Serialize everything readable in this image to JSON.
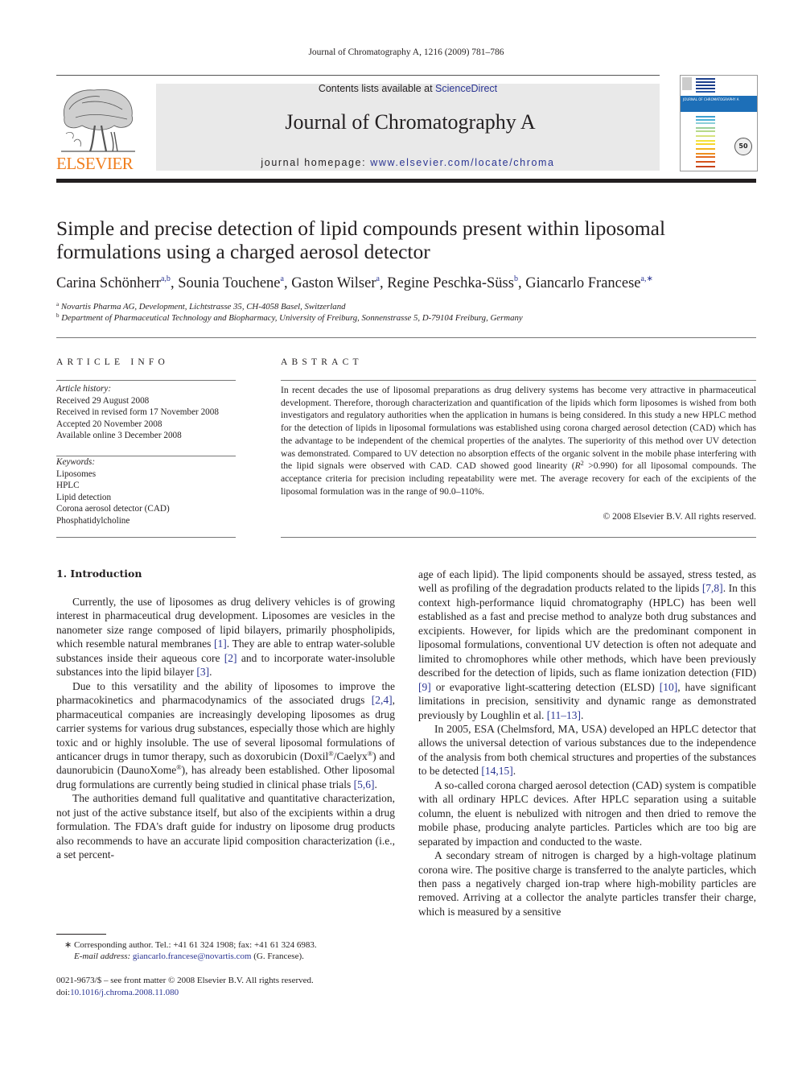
{
  "running_head": "Journal of Chromatography A, 1216 (2009) 781–786",
  "masthead": {
    "publisher_logo": "ELSEVIER",
    "contents_prefix": "Contents lists available at ",
    "contents_link": "ScienceDirect",
    "journal_title": "Journal of Chromatography A",
    "homepage_prefix": "journal homepage: ",
    "homepage_link": "www.elsevier.com/locate/chroma",
    "cover": {
      "band_title": "JOURNAL OF CHROMATOGRAPHY A",
      "seal_text": "50",
      "stripe_colors": [
        "#1c3f8c",
        "#1c3f8c",
        "#1c3f8c",
        "#1c3f8c",
        "#2a5aa8",
        "#3ea0d0",
        "#4db3d6",
        "#8ccfd8",
        "#9ccf9a",
        "#b6d98a",
        "#d7e27c",
        "#f3e23a",
        "#f6d62a",
        "#f3b31f",
        "#ee8f1e",
        "#e46a1e",
        "#d6541b",
        "#c8431a"
      ]
    }
  },
  "article": {
    "title": "Simple and precise detection of lipid compounds present within liposomal formulations using a charged aerosol detector",
    "authors": [
      {
        "name": "Carina Schönherr",
        "aff": "a,b"
      },
      {
        "name": "Sounia Touchene",
        "aff": "a"
      },
      {
        "name": "Gaston Wilser",
        "aff": "a"
      },
      {
        "name": "Regine Peschka-Süss",
        "aff": "b"
      },
      {
        "name": "Giancarlo Francese",
        "aff": "a,∗"
      }
    ],
    "affiliations": [
      {
        "mark": "a",
        "text": "Novartis Pharma AG, Development, Lichtstrasse 35, CH-4058 Basel, Switzerland"
      },
      {
        "mark": "b",
        "text": "Department of Pharmaceutical Technology and Biopharmacy, University of Freiburg, Sonnenstrasse 5, D-79104 Freiburg, Germany"
      }
    ]
  },
  "article_info": {
    "heading": "ARTICLE INFO",
    "history_label": "Article history:",
    "history": [
      "Received 29 August 2008",
      "Received in revised form 17 November 2008",
      "Accepted 20 November 2008",
      "Available online 3 December 2008"
    ],
    "keywords_label": "Keywords:",
    "keywords": [
      "Liposomes",
      "HPLC",
      "Lipid detection",
      "Corona aerosol detector (CAD)",
      "Phosphatidylcholine"
    ]
  },
  "abstract": {
    "heading": "ABSTRACT",
    "text_1": "In recent decades the use of liposomal preparations as drug delivery systems has become very attractive in pharmaceutical development. Therefore, thorough characterization and quantification of the lipids which form liposomes is wished from both investigators and regulatory authorities when the application in humans is being considered. In this study a new HPLC method for the detection of lipids in liposomal formulations was established using corona charged aerosol detection (CAD) which has the advantage to be independent of the chemical properties of the analytes. The superiority of this method over UV detection was demonstrated. Compared to UV detection no absorption effects of the organic solvent in the mobile phase interfering with the lipid signals were observed with CAD. CAD showed good linearity (",
    "r_symbol": "R",
    "r_sup": "2",
    "text_2": " >0.990) for all liposomal compounds. The acceptance criteria for precision including repeatability were met. The average recovery for each of the excipients of the liposomal formulation was in the range of 90.0–110%.",
    "copyright": "© 2008 Elsevier B.V. All rights reserved."
  },
  "introduction": {
    "heading": "1.  Introduction",
    "p1": {
      "a": "Currently, the use of liposomes as drug delivery vehicles is of growing interest in pharmaceutical drug development. Liposomes are vesicles in the nanometer size range composed of lipid bilayers, primarily phospholipids, which resemble natural membranes ",
      "ref1": "[1]",
      "b": ". They are able to entrap water-soluble substances inside their aqueous core ",
      "ref2": "[2]",
      "c": " and to incorporate water-insoluble substances into the lipid bilayer ",
      "ref3": "[3]",
      "d": "."
    },
    "p2": {
      "a": "Due to this versatility and the ability of liposomes to improve the pharmacokinetics and pharmacodynamics of the associated drugs ",
      "ref1": "[2,4]",
      "b": ", pharmaceutical companies are increasingly developing liposomes as drug carrier systems for various drug substances, especially those which are highly toxic and or highly insoluble. The use of several liposomal formulations of anticancer drugs in tumor therapy, such as doxorubicin (Doxil",
      "reg": "®",
      "c": "/Caelyx",
      "d": ") and daunorubicin (DaunoXome",
      "e": "), has already been established. Other liposomal drug formulations are currently being studied in clinical phase trials ",
      "ref2": "[5,6]",
      "f": "."
    },
    "p3": {
      "a": "The authorities demand full qualitative and quantitative characterization, not just of the active substance itself, but also of the excipients within a drug formulation. The FDA's draft guide for industry on liposome drug products also recommends to have an accurate lipid composition characterization (i.e., a set percentage of each lipid). The lipid components should be assayed, stress tested, as well as profiling of the degradation products related to the lipids ",
      "ref1": "[7,8]",
      "b": ". In this context high-performance liquid chromatography (HPLC) has been well established as a fast and precise method to analyze both drug substances and excipients. However, for lipids which are the predominant component in liposomal formulations, conventional UV detection is often not adequate and limited to chromophores while other methods, which have been previously described for the detection of lipids, such as flame ionization detection (FID) ",
      "ref2": "[9]",
      "c": " or evaporative light-scattering detection (ELSD) ",
      "ref3": "[10]",
      "d": ", have significant limitations in precision, sensitivity and dynamic range as demonstrated previously by Loughlin et al. ",
      "ref4": "[11–13]",
      "e": "."
    },
    "p4": {
      "a": "In 2005, ESA (Chelmsford, MA, USA) developed an HPLC detector that allows the universal detection of various substances due to the independence of the analysis from both chemical structures and properties of the substances to be detected ",
      "ref1": "[14,15]",
      "b": "."
    },
    "p5": "A so-called corona charged aerosol detection (CAD) system is compatible with all ordinary HPLC devices. After HPLC separation using a suitable column, the eluent is nebulized with nitrogen and then dried to remove the mobile phase, producing analyte particles. Particles which are too big are separated by impaction and conducted to the waste.",
    "p6": "A secondary stream of nitrogen is charged by a high-voltage platinum corona wire. The positive charge is transferred to the analyte particles, which then pass a negatively charged ion-trap where high-mobility particles are removed. Arriving at a collector the analyte particles transfer their charge, which is measured by a sensitive"
  },
  "footnotes": {
    "corresponding": "∗  Corresponding author. Tel.: +41 61 324 1908; fax: +41 61 324 6983.",
    "email_label": "E-mail address: ",
    "email": "giancarlo.francese@novartis.com",
    "email_suffix": " (G. Francese).",
    "issn": "0021-9673/$ – see front matter © 2008 Elsevier B.V. All rights reserved.",
    "doi_label": "doi:",
    "doi": "10.1016/j.chroma.2008.11.080"
  },
  "colors": {
    "link": "#2b3593",
    "elsevier_orange": "#f07e1d",
    "masthead_bg": "#e9e9e9"
  }
}
